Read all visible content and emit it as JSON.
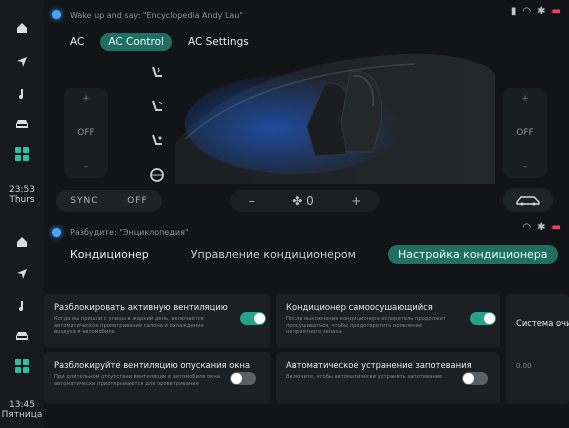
{
  "top_screen": {
    "assistant_hint": "Wake up and say: \"Encyclopedia Andy Lau\"",
    "tabs": [
      "AC",
      "AC Control",
      "AC Settings"
    ],
    "left_temp": {
      "up": "+",
      "value": "OFF",
      "down": "–"
    },
    "right_temp": {
      "up": "+",
      "value": "OFF",
      "down": "–"
    },
    "sync": {
      "label": "SYNC",
      "state": "OFF"
    },
    "fan": {
      "minus": "–",
      "value": "0",
      "plus": "+"
    },
    "sidebar_time": {
      "time": "23:53",
      "day": "Thurs"
    },
    "icons": {
      "home": "home-icon",
      "nav": "navigation-icon",
      "music": "music-icon",
      "car": "car-icon",
      "apps": "apps-icon"
    }
  },
  "bottom_screen": {
    "assistant_hint": "Разбудите: \"Энциклопедия\"",
    "tabs": [
      "Кондиционер",
      "Управление кондиционером",
      "Настройка кондиционера"
    ],
    "sidebar_time": {
      "time": "13:45",
      "day": "Пятница"
    },
    "cards": [
      {
        "title": "Разблокировать активную вентиляцию",
        "desc": "Когда вы пришли с улицы в жаркий день, включается автоматическое проветривание салона и охлаждение воздуха в автомобиле",
        "toggle": "on"
      },
      {
        "title": "Кондиционер самоосушающийся",
        "desc": "После выключения кондиционера испаритель продолжит просушиваться, чтобы предотвратить появление неприятного запаха",
        "toggle": "on"
      },
      {
        "title": "Система очистки",
        "desc": "",
        "value": "0.00"
      },
      {
        "title": "Разблокируйте вентиляцию опускания окна",
        "desc": "При длительном отсутствии вентиляции в автомобиле окна автоматически приоткрываются для проветривания",
        "toggle": "off"
      },
      {
        "title": "Автоматическое устранение запотевания",
        "desc": "Включите, чтобы автоматически устранять запотевание",
        "toggle": "off"
      }
    ]
  },
  "colors": {
    "accent": "#1f6f63",
    "toggle_on": "#27a28a",
    "toggle_off": "#5a5f64",
    "assistant": "#4aa3ff",
    "battery": "#e24a6a"
  }
}
